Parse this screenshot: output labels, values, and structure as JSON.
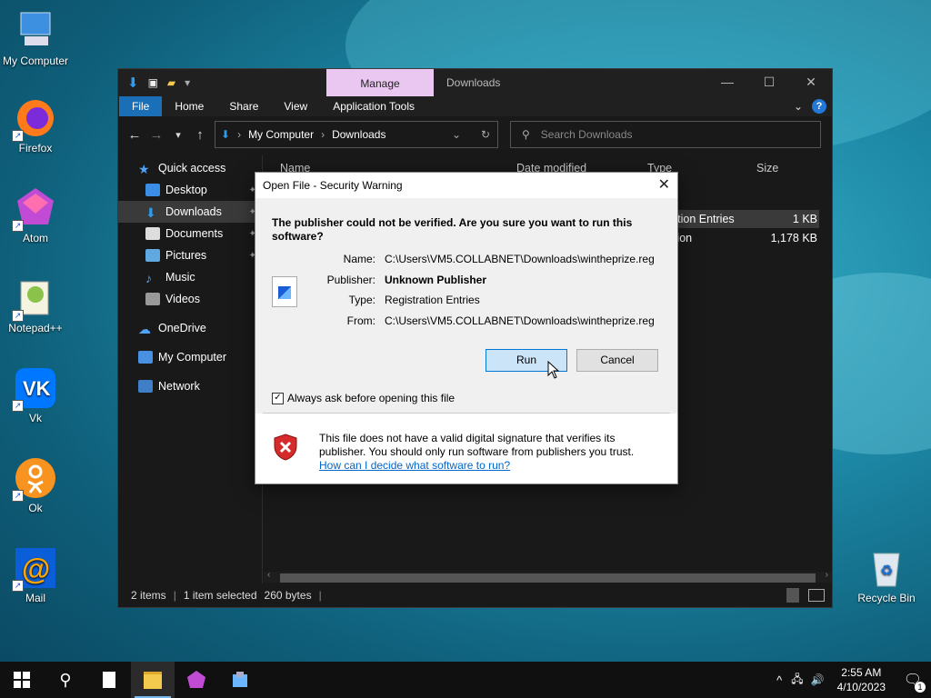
{
  "desktop": {
    "icons": [
      {
        "label": "My Computer"
      },
      {
        "label": "Firefox"
      },
      {
        "label": "Atom"
      },
      {
        "label": "Notepad++"
      },
      {
        "label": "Vk"
      },
      {
        "label": "Ok"
      },
      {
        "label": "Mail"
      },
      {
        "label": "Recycle Bin"
      }
    ]
  },
  "explorer": {
    "manage_tab": "Manage",
    "title": "Downloads",
    "ribbon_tabs": [
      "File",
      "Home",
      "Share",
      "View",
      "Application Tools"
    ],
    "address": {
      "root": "My Computer",
      "folder": "Downloads"
    },
    "search_placeholder": "Search Downloads",
    "nav": {
      "quick_access": "Quick access",
      "desktop": "Desktop",
      "downloads": "Downloads",
      "documents": "Documents",
      "pictures": "Pictures",
      "music": "Music",
      "videos": "Videos",
      "onedrive": "OneDrive",
      "my_computer": "My Computer",
      "network": "Network"
    },
    "columns": {
      "name": "Name",
      "date": "Date modified",
      "type": "Type",
      "size": "Size"
    },
    "files": [
      {
        "type": "ration Entries",
        "size": "1 KB"
      },
      {
        "type": "ation",
        "size": "1,178 KB"
      }
    ],
    "status": {
      "items": "2 items",
      "selected": "1 item selected",
      "bytes": "260 bytes"
    }
  },
  "dialog": {
    "title": "Open File - Security Warning",
    "question": "The publisher could not be verified.  Are you sure you want to run this software?",
    "fields": {
      "name_label": "Name:",
      "name_value": "C:\\Users\\VM5.COLLABNET\\Downloads\\wintheprize.reg",
      "publisher_label": "Publisher:",
      "publisher_value": "Unknown Publisher",
      "type_label": "Type:",
      "type_value": "Registration Entries",
      "from_label": "From:",
      "from_value": "C:\\Users\\VM5.COLLABNET\\Downloads\\wintheprize.reg"
    },
    "run_label": "Run",
    "cancel_label": "Cancel",
    "checkbox_label": "Always ask before opening this file",
    "checkbox_checked": true,
    "warning_text": "This file does not have a valid digital signature that verifies its publisher.  You should only run software from publishers you trust.",
    "help_link": "How can I decide what software to run?"
  },
  "taskbar": {
    "time": "2:55 AM",
    "date": "4/10/2023",
    "notification_count": "1"
  }
}
